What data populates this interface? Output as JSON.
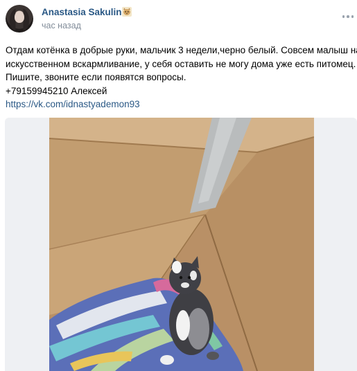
{
  "post": {
    "author": "Anastasia Sakulina",
    "time": "час назад",
    "text_lines": [
      "Отдам котёнка в добрые руки, мальчик 3 недели,черно белый. Совсем малыш на",
      "искусственном вскармливание, у себя оставить не могу дома уже есть питомец.",
      "Пишите, звоните если появятся вопросы.",
      "+79159945210 Алексей"
    ],
    "link": "https://vk.com/idnastyademon93"
  },
  "icons": {
    "badge": "cat-emoji-icon",
    "menu": "more-dots-icon"
  },
  "colors": {
    "link": "#2a5885",
    "meta": "#818c99",
    "box": "#c9a77f",
    "tape": "#b9bcbd",
    "blanket": "#5b6fb8"
  }
}
